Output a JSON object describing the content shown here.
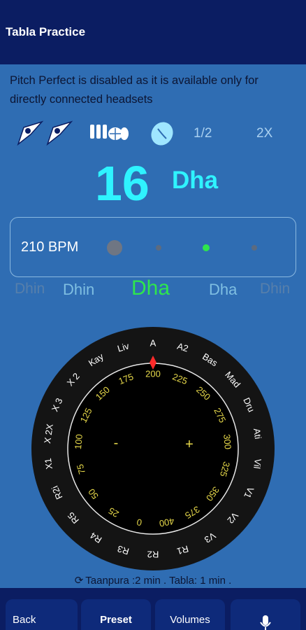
{
  "app": {
    "title": "Tabla Practice"
  },
  "notice": "Pitch Perfect is disabled as it is available only for directly connected headsets",
  "toolbar": {
    "icons": [
      "tabla-pair-icon",
      "tabla-pair-icon-2",
      "drum-set-icon",
      "coin-icon"
    ],
    "fraction": "1/2",
    "speed": "2X"
  },
  "beat": {
    "number": "16",
    "bol": "Dha"
  },
  "metronome": {
    "bpm_label": "210 BPM"
  },
  "bols": [
    "Dhin",
    "Dhin",
    "Dha",
    "Dha",
    "Dhin"
  ],
  "dial": {
    "outer_labels": [
      "A",
      "A2",
      "Bas",
      "Mad",
      "Dru",
      "Ati",
      "Vil",
      "V1",
      "V2",
      "V3",
      "R1",
      "R2",
      "R3",
      "R4",
      "R5",
      "R2i",
      "X1",
      "X 2X",
      "X 3",
      "X 2",
      "Kay",
      "Liv"
    ],
    "inner_labels": [
      "200",
      "225",
      "250",
      "275",
      "300",
      "325",
      "350",
      "375",
      "400",
      "0",
      "25",
      "50",
      "75",
      "100",
      "125",
      "150",
      "175"
    ],
    "minus": "-",
    "plus": "+"
  },
  "status": "Taanpura :2 min . Tabla: 1 min .",
  "buttons": {
    "back": "Back",
    "preset": "Preset",
    "volumes": "Volumes"
  },
  "colors": {
    "appbar": "#0b1d62",
    "background": "#2f6db3",
    "accent": "#2ff3ff",
    "active_bol": "#2ee64d",
    "dial_text": "#e6d84a"
  }
}
